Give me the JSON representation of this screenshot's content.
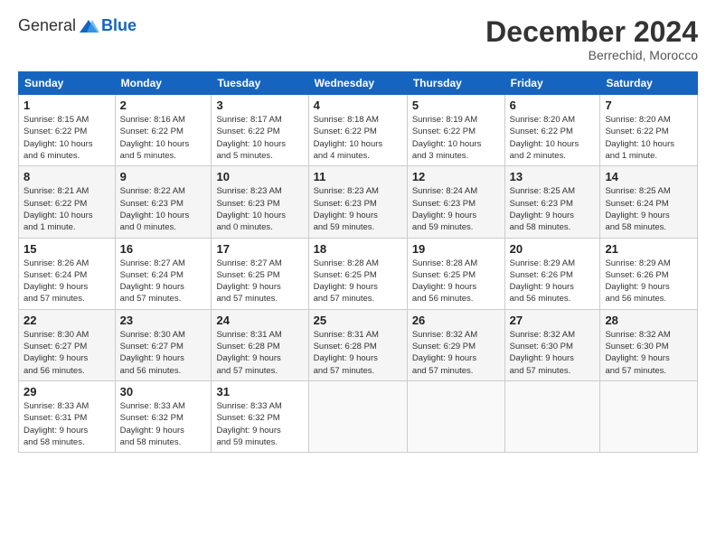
{
  "logo": {
    "general": "General",
    "blue": "Blue"
  },
  "header": {
    "month": "December 2024",
    "location": "Berrechid, Morocco"
  },
  "weekdays": [
    "Sunday",
    "Monday",
    "Tuesday",
    "Wednesday",
    "Thursday",
    "Friday",
    "Saturday"
  ],
  "weeks": [
    [
      {
        "day": "1",
        "info": "Sunrise: 8:15 AM\nSunset: 6:22 PM\nDaylight: 10 hours\nand 6 minutes."
      },
      {
        "day": "2",
        "info": "Sunrise: 8:16 AM\nSunset: 6:22 PM\nDaylight: 10 hours\nand 5 minutes."
      },
      {
        "day": "3",
        "info": "Sunrise: 8:17 AM\nSunset: 6:22 PM\nDaylight: 10 hours\nand 5 minutes."
      },
      {
        "day": "4",
        "info": "Sunrise: 8:18 AM\nSunset: 6:22 PM\nDaylight: 10 hours\nand 4 minutes."
      },
      {
        "day": "5",
        "info": "Sunrise: 8:19 AM\nSunset: 6:22 PM\nDaylight: 10 hours\nand 3 minutes."
      },
      {
        "day": "6",
        "info": "Sunrise: 8:20 AM\nSunset: 6:22 PM\nDaylight: 10 hours\nand 2 minutes."
      },
      {
        "day": "7",
        "info": "Sunrise: 8:20 AM\nSunset: 6:22 PM\nDaylight: 10 hours\nand 1 minute."
      }
    ],
    [
      {
        "day": "8",
        "info": "Sunrise: 8:21 AM\nSunset: 6:22 PM\nDaylight: 10 hours\nand 1 minute."
      },
      {
        "day": "9",
        "info": "Sunrise: 8:22 AM\nSunset: 6:23 PM\nDaylight: 10 hours\nand 0 minutes."
      },
      {
        "day": "10",
        "info": "Sunrise: 8:23 AM\nSunset: 6:23 PM\nDaylight: 10 hours\nand 0 minutes."
      },
      {
        "day": "11",
        "info": "Sunrise: 8:23 AM\nSunset: 6:23 PM\nDaylight: 9 hours\nand 59 minutes."
      },
      {
        "day": "12",
        "info": "Sunrise: 8:24 AM\nSunset: 6:23 PM\nDaylight: 9 hours\nand 59 minutes."
      },
      {
        "day": "13",
        "info": "Sunrise: 8:25 AM\nSunset: 6:23 PM\nDaylight: 9 hours\nand 58 minutes."
      },
      {
        "day": "14",
        "info": "Sunrise: 8:25 AM\nSunset: 6:24 PM\nDaylight: 9 hours\nand 58 minutes."
      }
    ],
    [
      {
        "day": "15",
        "info": "Sunrise: 8:26 AM\nSunset: 6:24 PM\nDaylight: 9 hours\nand 57 minutes."
      },
      {
        "day": "16",
        "info": "Sunrise: 8:27 AM\nSunset: 6:24 PM\nDaylight: 9 hours\nand 57 minutes."
      },
      {
        "day": "17",
        "info": "Sunrise: 8:27 AM\nSunset: 6:25 PM\nDaylight: 9 hours\nand 57 minutes."
      },
      {
        "day": "18",
        "info": "Sunrise: 8:28 AM\nSunset: 6:25 PM\nDaylight: 9 hours\nand 57 minutes."
      },
      {
        "day": "19",
        "info": "Sunrise: 8:28 AM\nSunset: 6:25 PM\nDaylight: 9 hours\nand 56 minutes."
      },
      {
        "day": "20",
        "info": "Sunrise: 8:29 AM\nSunset: 6:26 PM\nDaylight: 9 hours\nand 56 minutes."
      },
      {
        "day": "21",
        "info": "Sunrise: 8:29 AM\nSunset: 6:26 PM\nDaylight: 9 hours\nand 56 minutes."
      }
    ],
    [
      {
        "day": "22",
        "info": "Sunrise: 8:30 AM\nSunset: 6:27 PM\nDaylight: 9 hours\nand 56 minutes."
      },
      {
        "day": "23",
        "info": "Sunrise: 8:30 AM\nSunset: 6:27 PM\nDaylight: 9 hours\nand 56 minutes."
      },
      {
        "day": "24",
        "info": "Sunrise: 8:31 AM\nSunset: 6:28 PM\nDaylight: 9 hours\nand 57 minutes."
      },
      {
        "day": "25",
        "info": "Sunrise: 8:31 AM\nSunset: 6:28 PM\nDaylight: 9 hours\nand 57 minutes."
      },
      {
        "day": "26",
        "info": "Sunrise: 8:32 AM\nSunset: 6:29 PM\nDaylight: 9 hours\nand 57 minutes."
      },
      {
        "day": "27",
        "info": "Sunrise: 8:32 AM\nSunset: 6:30 PM\nDaylight: 9 hours\nand 57 minutes."
      },
      {
        "day": "28",
        "info": "Sunrise: 8:32 AM\nSunset: 6:30 PM\nDaylight: 9 hours\nand 57 minutes."
      }
    ],
    [
      {
        "day": "29",
        "info": "Sunrise: 8:33 AM\nSunset: 6:31 PM\nDaylight: 9 hours\nand 58 minutes."
      },
      {
        "day": "30",
        "info": "Sunrise: 8:33 AM\nSunset: 6:32 PM\nDaylight: 9 hours\nand 58 minutes."
      },
      {
        "day": "31",
        "info": "Sunrise: 8:33 AM\nSunset: 6:32 PM\nDaylight: 9 hours\nand 59 minutes."
      },
      null,
      null,
      null,
      null
    ]
  ]
}
